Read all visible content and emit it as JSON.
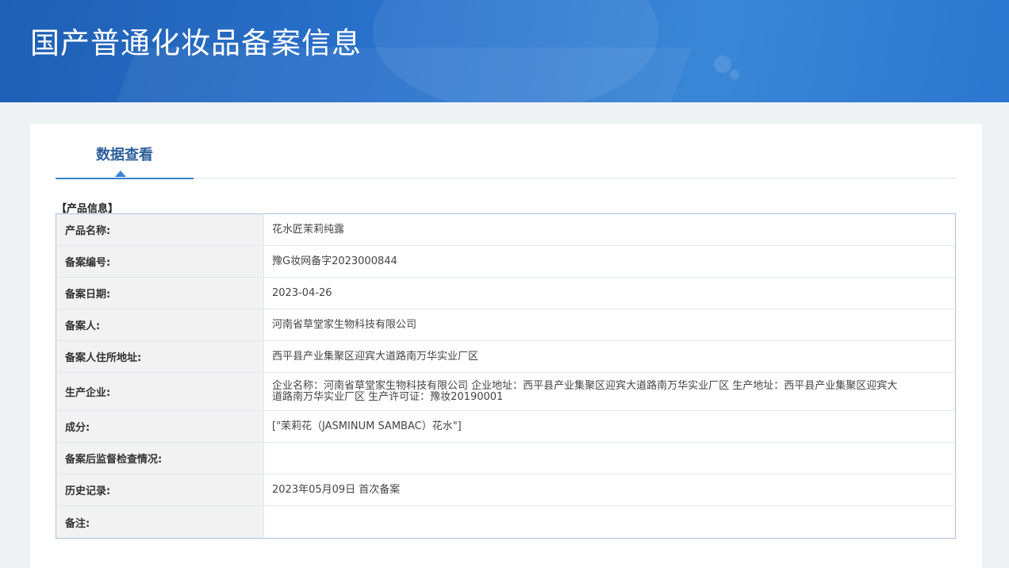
{
  "header": {
    "title": "国产普通化妆品备案信息"
  },
  "tabs": [
    {
      "label": "数据查看"
    }
  ],
  "section": {
    "title": "【产品信息】"
  },
  "rows": [
    {
      "label": "产品名称:",
      "value": "花水匠茉莉纯露"
    },
    {
      "label": "备案编号:",
      "value": "豫G妆网备字2023000844"
    },
    {
      "label": "备案日期:",
      "value": "2023-04-26"
    },
    {
      "label": "备案人:",
      "value": "河南省草堂家生物科技有限公司"
    },
    {
      "label": "备案人住所地址:",
      "value": "西平县产业集聚区迎宾大道路南万华实业厂区"
    },
    {
      "label": "生产企业:",
      "value": "企业名称：河南省草堂家生物科技有限公司 企业地址：西平县产业集聚区迎宾大道路南万华实业厂区 生产地址：西平县产业集聚区迎宾大道路南万华实业厂区 生产许可证：豫妆20190001"
    },
    {
      "label": "成分:",
      "value": "[\"茉莉花（JASMINUM SAMBAC）花水\"]"
    },
    {
      "label": "备案后监督检查情况:",
      "value": ""
    },
    {
      "label": "历史记录:",
      "value": "2023年05月09日 首次备案"
    },
    {
      "label": "备注:",
      "value": ""
    }
  ]
}
